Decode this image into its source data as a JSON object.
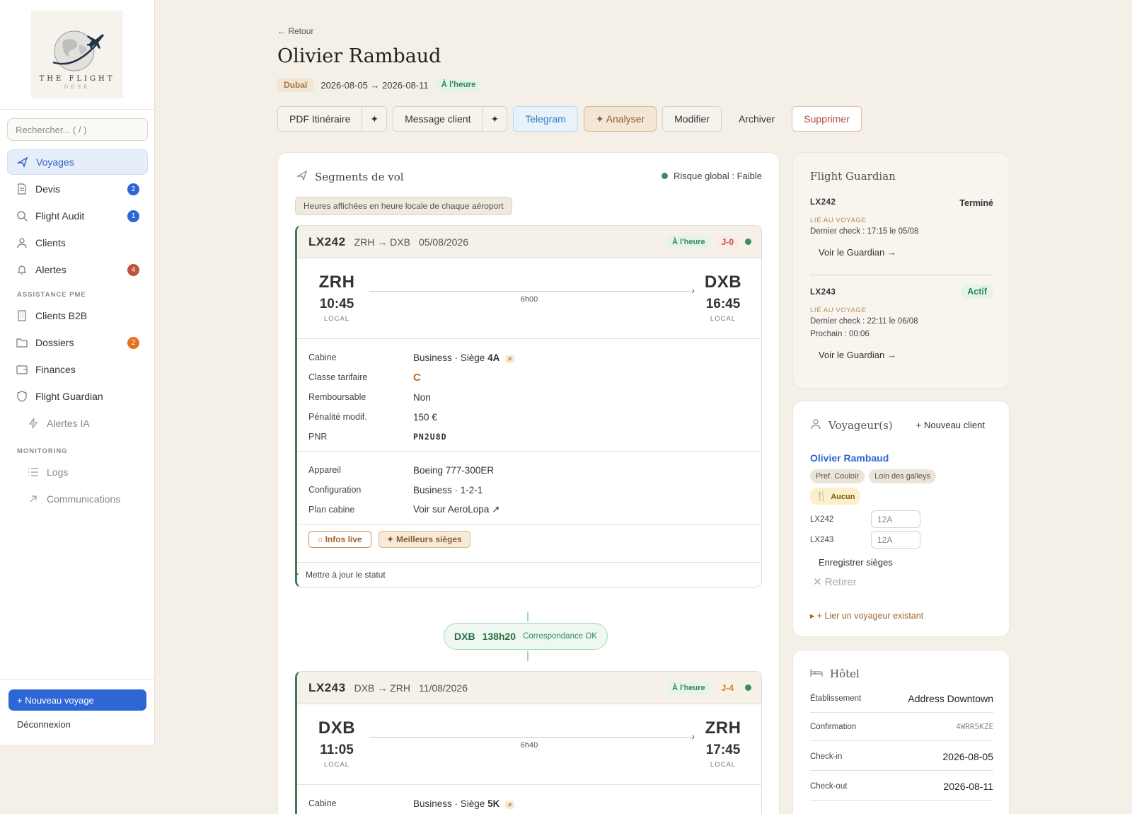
{
  "sidebar": {
    "logo_text": "THE FLIGHT",
    "logo_sub": "DESK",
    "search_placeholder": "Rechercher...  ( / )",
    "items": [
      {
        "label": "Voyages"
      },
      {
        "label": "Devis",
        "badge": "2"
      },
      {
        "label": "Flight Audit",
        "badge": "1"
      },
      {
        "label": "Clients"
      },
      {
        "label": "Alertes",
        "badge": "4"
      }
    ],
    "section_pme": "ASSISTANCE PME",
    "pme_items": [
      {
        "label": "Clients B2B"
      },
      {
        "label": "Dossiers",
        "badge": "2"
      },
      {
        "label": "Finances"
      },
      {
        "label": "Flight Guardian"
      },
      {
        "label": "Alertes IA"
      }
    ],
    "section_monitoring": "MONITORING",
    "monitoring_items": [
      {
        "label": "Logs"
      },
      {
        "label": "Communications"
      }
    ],
    "new_trip": "+ Nouveau voyage",
    "logout": "Déconnexion"
  },
  "header": {
    "back": "← Retour",
    "title": "Olivier Rambaud",
    "destination": "Dubaï",
    "dates": "2026-08-05 → 2026-08-11",
    "status": "À l'heure"
  },
  "actions": {
    "pdf": "PDF Itinéraire",
    "spark": "✦",
    "message": "Message client",
    "telegram": "Telegram",
    "analyse": "✦ Analyser",
    "modifier": "Modifier",
    "archiver": "Archiver",
    "supprimer": "Supprimer"
  },
  "segments": {
    "title": "Segments de vol",
    "risk": "Risque global : Faible",
    "note": "Heures affichées en heure locale de chaque aéroport",
    "local": "LOCAL",
    "flights": [
      {
        "no": "LX242",
        "route": "ZRH → DXB",
        "date": "05/08/2026",
        "status": "À l'heure",
        "j": "J-0",
        "from": "ZRH",
        "dep": "10:45",
        "to": "DXB",
        "arr": "16:45",
        "duration": "6h00",
        "cabine_k": "Cabine",
        "cabine_v": "Business · Siège ",
        "seat": "4A",
        "eq": "≠",
        "classe_k": "Classe tarifaire",
        "classe_v": "C",
        "remb_k": "Remboursable",
        "remb_v": "Non",
        "pen_k": "Pénalité modif.",
        "pen_v": "150 €",
        "pnr_k": "PNR",
        "pnr_v": "PN2U8D",
        "app_k": "Appareil",
        "app_v": "Boeing 777-300ER",
        "conf_k": "Configuration",
        "conf_v": "Business · 1-2-1",
        "plan_k": "Plan cabine",
        "plan_v": "Voir sur AeroLopa ↗",
        "chip_live": "○ Infos live",
        "chip_seats": "✦ Meilleurs sièges",
        "update": "Mettre à jour le statut"
      },
      {
        "no": "LX243",
        "route": "DXB → ZRH",
        "date": "11/08/2026",
        "status": "À l'heure",
        "j": "J-4",
        "from": "DXB",
        "dep": "11:05",
        "to": "ZRH",
        "arr": "17:45",
        "duration": "6h40",
        "cabine_k": "Cabine",
        "cabine_v": "Business · Siège ",
        "seat": "5K",
        "eq": "≠"
      }
    ],
    "connection": {
      "airport": "DXB",
      "duration": "138h20",
      "label": "Correspondance OK"
    }
  },
  "guardian": {
    "title": "Flight Guardian",
    "items": [
      {
        "no": "LX242",
        "status": "Terminé",
        "lie": "LIÉ AU VOYAGE",
        "check": "Dernier check : 17:15 le 05/08",
        "link": "Voir le Guardian →"
      },
      {
        "no": "LX243",
        "status": "Actif",
        "lie": "LIÉ AU VOYAGE",
        "check": "Dernier check : 22:11 le 06/08",
        "next": "Prochain : 00:06",
        "link": "Voir le Guardian →"
      }
    ]
  },
  "travelers": {
    "title": "Voyageur(s)",
    "new_client": "+ Nouveau client",
    "name": "Olivier Rambaud",
    "tags": [
      "Pref. Couloir",
      "Loin des galleys"
    ],
    "meal_tag": "Aucun",
    "seats": [
      {
        "flight": "LX242",
        "placeholder": "12A"
      },
      {
        "flight": "LX243",
        "placeholder": "12A"
      }
    ],
    "save": "Enregistrer sièges",
    "remove": "Retirer",
    "link_existing": "▸  + Lier un voyageur existant"
  },
  "hotel": {
    "title": "Hôtel",
    "rows": [
      {
        "k": "Établissement",
        "v": "Address Downtown"
      },
      {
        "k": "Confirmation",
        "v": "4WRR5KZE"
      },
      {
        "k": "Check-in",
        "v": "2026-08-05"
      },
      {
        "k": "Check-out",
        "v": "2026-08-11"
      }
    ]
  },
  "colors": {
    "accent": "#2f66d6",
    "ok": "#2f8a55",
    "badge_blue": "#2f66d6",
    "badge_red": "#c0533f",
    "badge_orange": "#e4711f"
  }
}
